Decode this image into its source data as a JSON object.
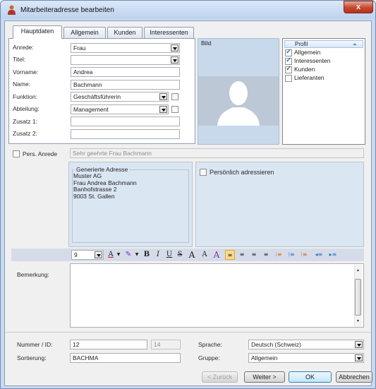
{
  "window": {
    "title": "Mitarbeiteradresse bearbeiten",
    "close": "x"
  },
  "tabs": [
    {
      "label": "Hauptdaten"
    },
    {
      "label": "Allgemein"
    },
    {
      "label": "Kunden"
    },
    {
      "label": "Interessenten"
    }
  ],
  "form": {
    "anrede_label": "Anrede:",
    "anrede_value": "Frau",
    "titel_label": "Titel:",
    "titel_value": "",
    "vorname_label": "Vorname:",
    "vorname_value": "Andrea",
    "name_label": "Name:",
    "name_value": "Bachmann",
    "funktion_label": "Funktion:",
    "funktion_value": "Geschäftsführerin",
    "abteilung_label": "Abteilung:",
    "abteilung_value": "Management",
    "zusatz1_label": "Zusatz 1:",
    "zusatz1_value": "",
    "zusatz2_label": "Zusatz 2:",
    "zusatz2_value": ""
  },
  "photo": {
    "label": "Bild"
  },
  "profile": {
    "header": "Profil",
    "items": [
      {
        "label": "Allgemein",
        "checked": true
      },
      {
        "label": "Interessenten",
        "checked": true
      },
      {
        "label": "Kunden",
        "checked": true
      },
      {
        "label": "Lieferanten",
        "checked": false
      }
    ]
  },
  "anrede": {
    "label": "Pers. Anrede",
    "value": "Sehr geehrte Frau Bachmann"
  },
  "generated_address": {
    "title": "Generierte Adresse",
    "lines": [
      "Muster AG",
      "Frau Andrea Bachmann",
      "Banhofstrasse 2",
      "9003 St. Gallen"
    ]
  },
  "personal": {
    "label": "Persönlich adressieren"
  },
  "toolbar": {
    "font_size": "9"
  },
  "bemerkung": {
    "label": "Bemerkung:",
    "value": ""
  },
  "footer": {
    "nummer_label": "Nummer / ID:",
    "nummer_value": "12",
    "id_value": "14",
    "sortierung_label": "Sortierung:",
    "sortierung_value": "BACHMA",
    "sprache_label": "Sprache:",
    "sprache_value": "Deutsch (Schweiz)",
    "gruppe_label": "Gruppe:",
    "gruppe_value": "Allgemein"
  },
  "buttons": {
    "back": "< Zurück",
    "next": "Weiter >",
    "ok": "OK",
    "cancel": "Abbrechen"
  }
}
